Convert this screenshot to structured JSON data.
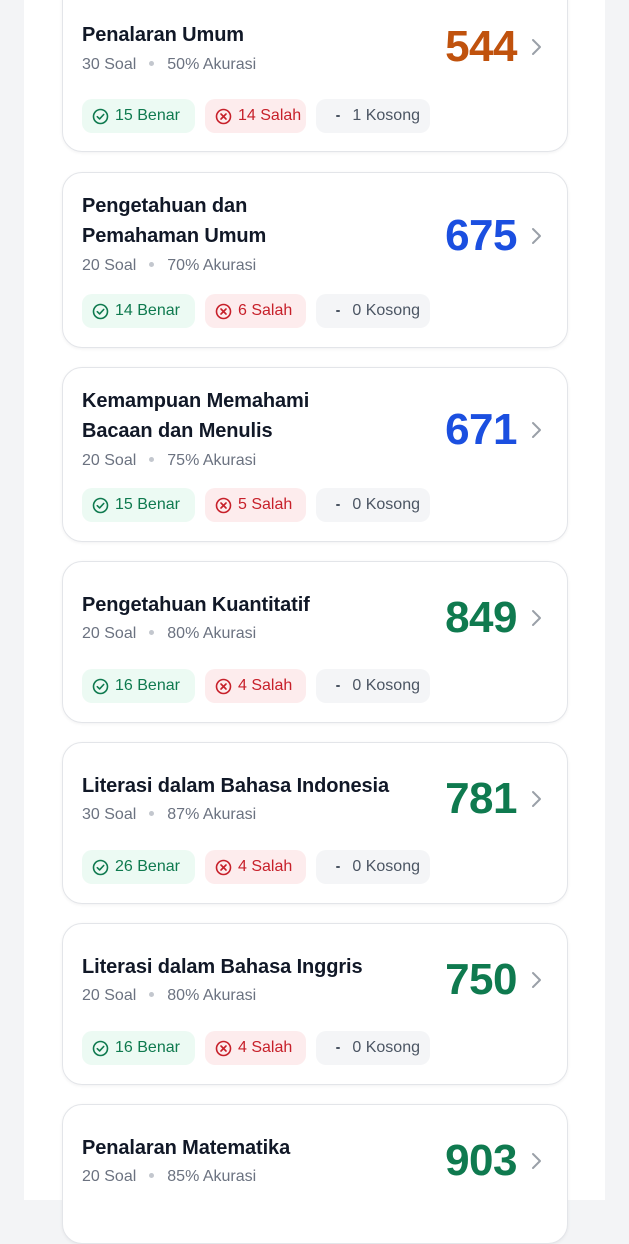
{
  "colors": {
    "score_orange": "#c0520d",
    "score_blue": "#1b4fe0",
    "score_green": "#0f7a4f"
  },
  "cards": [
    {
      "title": "Penalaran Umum",
      "soal": "30 Soal",
      "akurasi": "50% Akurasi",
      "score": "544",
      "score_color": "#c0520d",
      "benar": "15 Benar",
      "salah": "14 Salah",
      "kosong": "1 Kosong"
    },
    {
      "title": "Pengetahuan dan Pemahaman Umum",
      "soal": "20 Soal",
      "akurasi": "70% Akurasi",
      "score": "675",
      "score_color": "#1b4fe0",
      "benar": "14 Benar",
      "salah": "6 Salah",
      "kosong": "0 Kosong"
    },
    {
      "title": "Kemampuan Memahami Bacaan dan Menulis",
      "soal": "20 Soal",
      "akurasi": "75% Akurasi",
      "score": "671",
      "score_color": "#1b4fe0",
      "benar": "15 Benar",
      "salah": "5 Salah",
      "kosong": "0 Kosong"
    },
    {
      "title": "Pengetahuan Kuantitatif",
      "soal": "20 Soal",
      "akurasi": "80% Akurasi",
      "score": "849",
      "score_color": "#0f7a4f",
      "benar": "16 Benar",
      "salah": "4 Salah",
      "kosong": "0 Kosong"
    },
    {
      "title": "Literasi dalam Bahasa Indonesia",
      "soal": "30 Soal",
      "akurasi": "87% Akurasi",
      "score": "781",
      "score_color": "#0f7a4f",
      "benar": "26 Benar",
      "salah": "4 Salah",
      "kosong": "0 Kosong"
    },
    {
      "title": "Literasi dalam Bahasa Inggris",
      "soal": "20 Soal",
      "akurasi": "80% Akurasi",
      "score": "750",
      "score_color": "#0f7a4f",
      "benar": "16 Benar",
      "salah": "4 Salah",
      "kosong": "0 Kosong"
    },
    {
      "title": "Penalaran Matematika",
      "soal": "20 Soal",
      "akurasi": "85% Akurasi",
      "score": "903",
      "score_color": "#0f7a4f"
    }
  ]
}
